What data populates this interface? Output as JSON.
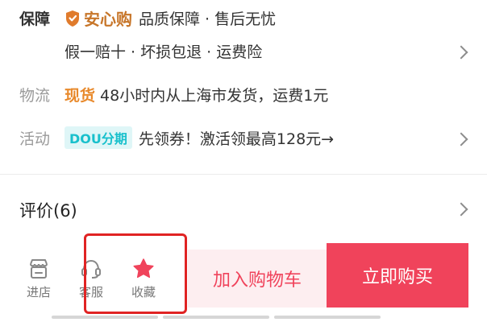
{
  "guarantee": {
    "label": "保障",
    "brand": "安心购",
    "headline": "品质保障 · 售后无忧",
    "details": "假一赔十 · 坏损包退 · 运费险"
  },
  "logistics": {
    "label": "物流",
    "tag": "现货",
    "text": "48小时内从上海市发货，运费1元"
  },
  "promotion": {
    "label": "活动",
    "badge": "DOU分期",
    "text": "先领券！激活领最高128元→"
  },
  "reviews": {
    "title": "评价(6)"
  },
  "bottom_bar": {
    "store_label": "进店",
    "service_label": "客服",
    "favorite_label": "收藏",
    "add_cart_label": "加入购物车",
    "buy_now_label": "立即购买"
  },
  "colors": {
    "accent": "#f0435b",
    "brand_orange": "#c7762a",
    "highlight": "#e02323"
  },
  "icons": {
    "brand": "shield-icon",
    "store": "store-icon",
    "service": "headset-icon",
    "favorite": "star-icon"
  }
}
